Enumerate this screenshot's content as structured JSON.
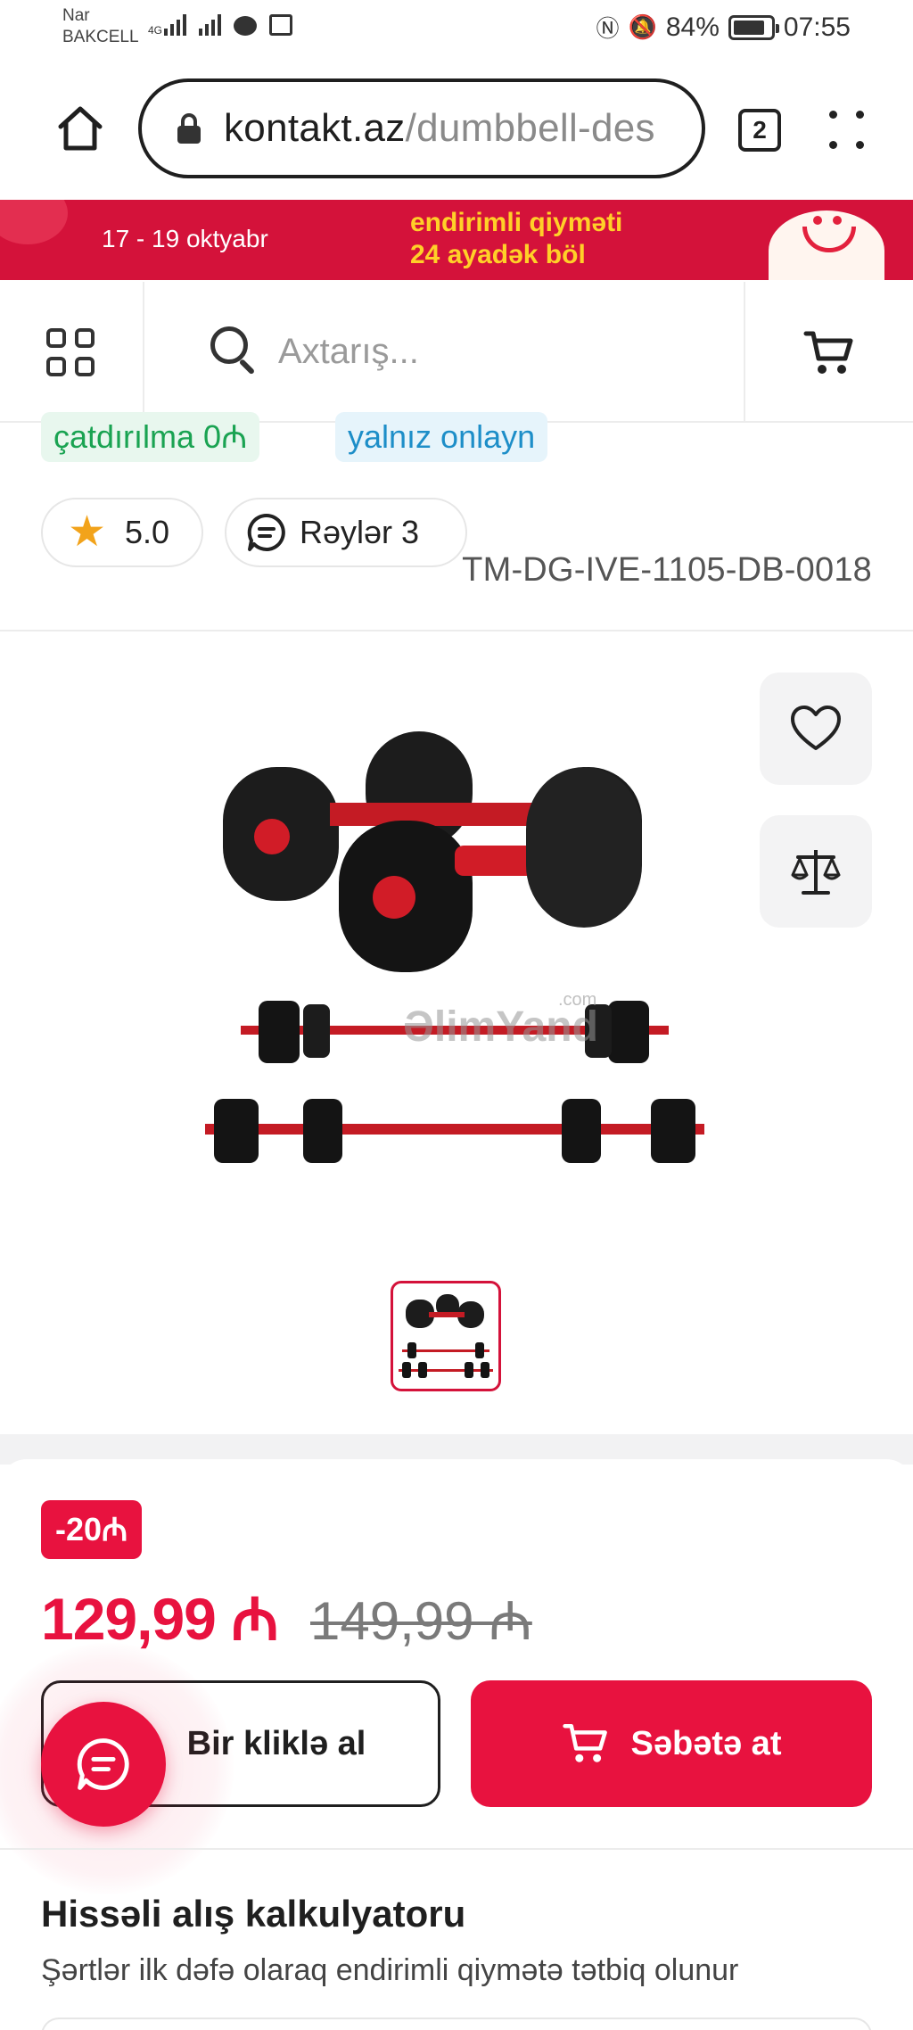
{
  "status_bar": {
    "carrier_1": "Nar",
    "carrier_2": "BAKCELL",
    "network": "4G",
    "battery": "84%",
    "time": "07:55"
  },
  "browser": {
    "url_host": "kontakt.az",
    "url_path": "/dumbbell-des",
    "tab_count": "2"
  },
  "banner": {
    "dates": "17 - 19 oktyabr",
    "title_line1": "endirimli qiymәti",
    "title_line2": "24 ayadәk böl"
  },
  "header": {
    "search_placeholder": "Axtarış..."
  },
  "product": {
    "chip_delivery": "çatdırılma 0₼",
    "chip_online": "yalnız onlayn",
    "rating": "5.0",
    "reviews_label": "Rәylәr 3",
    "sku": "TM-DG-IVE-1105-DB-0018",
    "watermark": "ƏlimYand",
    "watermark_suffix": ".com"
  },
  "pricing": {
    "discount_badge": "-20₼",
    "price_now": "129,99 ₼",
    "price_old": "149,99 ₼"
  },
  "actions": {
    "one_click": "Bir kliklә al",
    "add_to_cart": "Sәbәtә at"
  },
  "calculator": {
    "title": "Hissәli alış kalkulyatoru",
    "subtitle": "Şәrtlәr ilk dәfә olaraq endirimli qiymәtә tәtbiq olunur"
  },
  "colors": {
    "accent": "#e8123f",
    "banner_bg": "#d4123a",
    "banner_text": "#ffd028",
    "chip_green": "#1aa352",
    "chip_blue": "#1d8ec8",
    "star": "#f2a31b"
  },
  "icons": [
    "home-icon",
    "lock-icon",
    "menu-dots-icon",
    "catalog-grid-icon",
    "search-icon",
    "cart-icon",
    "star-icon",
    "chat-icon",
    "heart-icon",
    "compare-scale-icon"
  ]
}
